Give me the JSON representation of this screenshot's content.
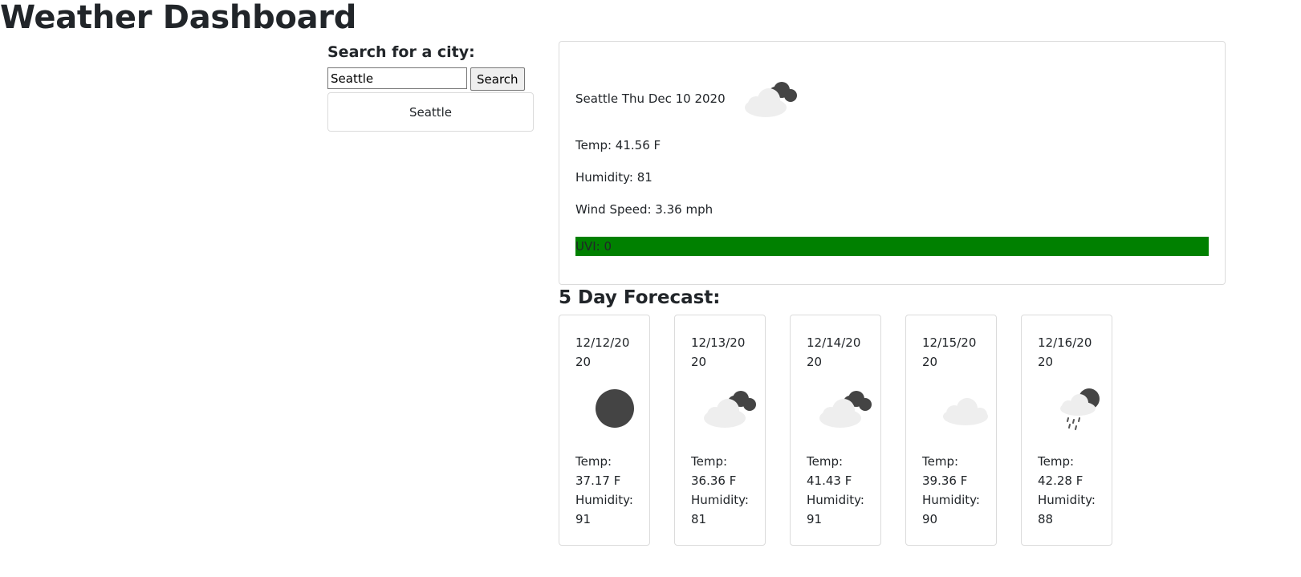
{
  "app": {
    "title": "Weather Dashboard"
  },
  "search": {
    "heading": "Search for a city:",
    "value": "Seattle",
    "button_label": "Search",
    "history": [
      "Seattle"
    ]
  },
  "current": {
    "title": "Seattle Thu Dec 10 2020",
    "icon": "broken-clouds-icon",
    "temp": "Temp: 41.56 F",
    "humidity": "Humidity: 81",
    "wind": "Wind Speed: 3.36 mph",
    "uvi": "UVI: 0",
    "uvi_color": "#008000"
  },
  "forecast": {
    "heading": "5 Day Forecast:",
    "days": [
      {
        "date": "12/12/2020",
        "icon": "clear-night-icon",
        "temp_label": "Temp:",
        "temp": "37.17 F",
        "humidity_label": "Humidity:",
        "humidity": "91"
      },
      {
        "date": "12/13/2020",
        "icon": "broken-clouds-icon",
        "temp_label": "Temp:",
        "temp": "36.36 F",
        "humidity_label": "Humidity:",
        "humidity": "81"
      },
      {
        "date": "12/14/2020",
        "icon": "broken-clouds-icon",
        "temp_label": "Temp:",
        "temp": "41.43 F",
        "humidity_label": "Humidity:",
        "humidity": "91"
      },
      {
        "date": "12/15/2020",
        "icon": "cloud-icon",
        "temp_label": "Temp:",
        "temp": "39.36 F",
        "humidity_label": "Humidity:",
        "humidity": "90"
      },
      {
        "date": "12/16/2020",
        "icon": "rain-night-icon",
        "temp_label": "Temp:",
        "temp": "42.28 F",
        "humidity_label": "Humidity:",
        "humidity": "88"
      }
    ]
  }
}
